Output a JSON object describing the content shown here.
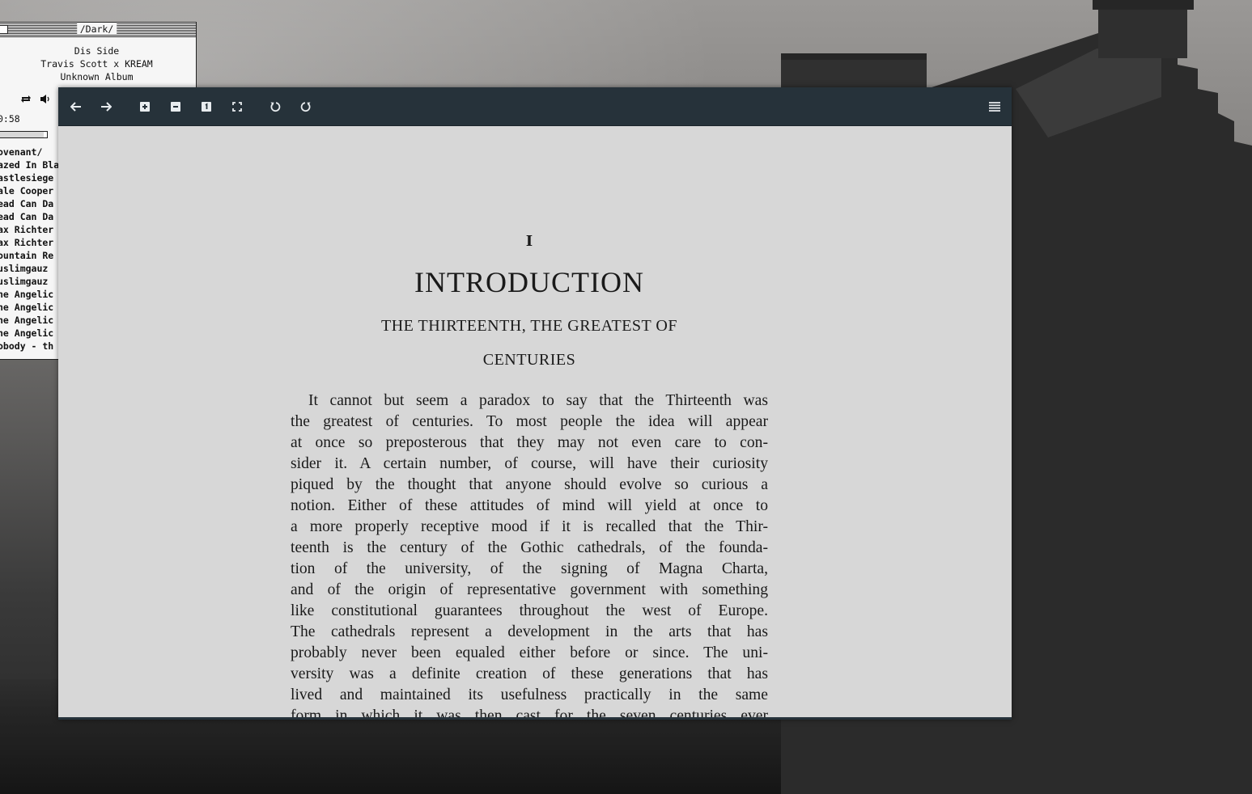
{
  "player": {
    "title": "/Dark/",
    "track": "Dis Side",
    "artist": "Travis Scott x KREAM",
    "album": "Unknown Album",
    "time": "0:58",
    "progress": 0.93,
    "playlist": [
      "ovenant/",
      "azed In Bla",
      "astlesiege",
      "ale Cooper",
      "ead Can Da",
      "ead Can Da",
      "ax Richter",
      "ax Richter",
      "ountain Re",
      "uslimgauz",
      "uslimgauz",
      "he Angelic",
      "he Angelic",
      "he Angelic",
      "he Angelic",
      "obody - th"
    ]
  },
  "document": {
    "chapter_number": "I",
    "chapter_title": "INTRODUCTION",
    "subtitle_line1": "THE THIRTEENTH, THE GREATEST OF",
    "subtitle_line2": "CENTURIES",
    "lines": [
      "It cannot but seem a paradox to say that the Thirteenth was",
      "the greatest of centuries.  To most people the idea will appear",
      "at once so preposterous that they may not even care to con-",
      "sider it.  A certain number, of course, will have their curiosity",
      "piqued by the thought that anyone should evolve so curious a",
      "notion.  Either of these attitudes of mind will yield at once to",
      "a more properly receptive mood if it is recalled that the Thir-",
      "teenth is the century of the Gothic cathedrals, of the founda-",
      "tion of the university, of the signing of Magna Charta,",
      "and of the origin of representative government with something",
      "like constitutional guarantees throughout the west of Europe.",
      "The cathedrals represent a development in the arts that has",
      "probably never been equaled either before or since.  The uni-",
      "versity was a definite creation of these generations that has",
      "lived and maintained its usefulness practically in the same",
      "form in which it was then cast for the seven centuries ever"
    ]
  },
  "icons": {
    "back": "arrow-left-icon",
    "forward": "arrow-right-icon",
    "zoom_in": "zoom-in-icon",
    "zoom_out": "zoom-out-icon",
    "actual_size": "actual-size-icon",
    "fit": "fullscreen-icon",
    "rotate_ccw": "rotate-ccw-icon",
    "rotate_cw": "rotate-cw-icon",
    "menu": "menu-icon"
  },
  "colors": {
    "toolbar": "#26323a",
    "page": "#d7d7d7",
    "icon": "#e8ecef"
  }
}
